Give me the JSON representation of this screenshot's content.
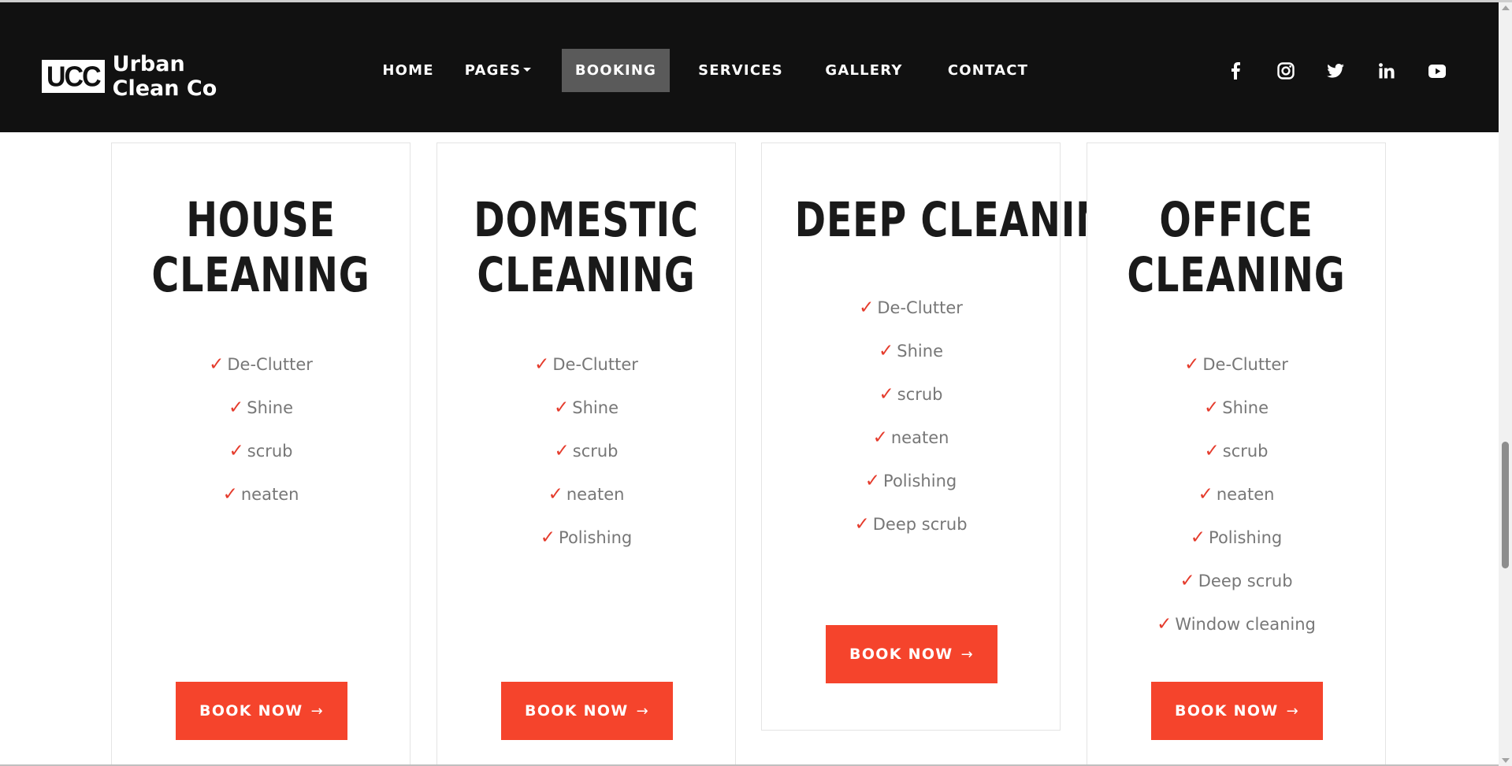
{
  "brand": {
    "mark": "UCC",
    "name_line1": "Urban",
    "name_line2": "Clean Co"
  },
  "nav": {
    "items": [
      {
        "label": "HOME"
      },
      {
        "label": "PAGES"
      },
      {
        "label": "BOOKING"
      },
      {
        "label": "SERVICES"
      },
      {
        "label": "GALLERY"
      },
      {
        "label": "CONTACT"
      }
    ],
    "active": "BOOKING"
  },
  "social": [
    "facebook-icon",
    "instagram-icon",
    "twitter-icon",
    "linkedin-icon",
    "youtube-icon"
  ],
  "check_mark": "✓",
  "button_arrow": "→",
  "cards": [
    {
      "title_line1": "HOUSE",
      "title_line2": "CLEANING",
      "features": [
        "De-Clutter",
        "Shine",
        "scrub",
        "neaten"
      ],
      "button": "BOOK NOW"
    },
    {
      "title_line1": "DOMESTIC",
      "title_line2": "CLEANING",
      "features": [
        "De-Clutter",
        "Shine",
        "scrub",
        "neaten",
        "Polishing"
      ],
      "button": "BOOK NOW"
    },
    {
      "title_line1": "DEEP CLEANING",
      "title_line2": "",
      "features": [
        "De-Clutter",
        "Shine",
        "scrub",
        "neaten",
        "Polishing",
        "Deep scrub"
      ],
      "button": "BOOK NOW"
    },
    {
      "title_line1": "OFFICE",
      "title_line2": "CLEANING",
      "features": [
        "De-Clutter",
        "Shine",
        "scrub",
        "neaten",
        "Polishing",
        "Deep scrub",
        "Window cleaning"
      ],
      "button": "BOOK NOW"
    }
  ],
  "colors": {
    "navbar": "#111111",
    "active_nav": "#5a5a5a",
    "accent": "#f5442c",
    "check": "#e53b2c",
    "title": "#1a1a1a",
    "feature_text": "#777777"
  }
}
